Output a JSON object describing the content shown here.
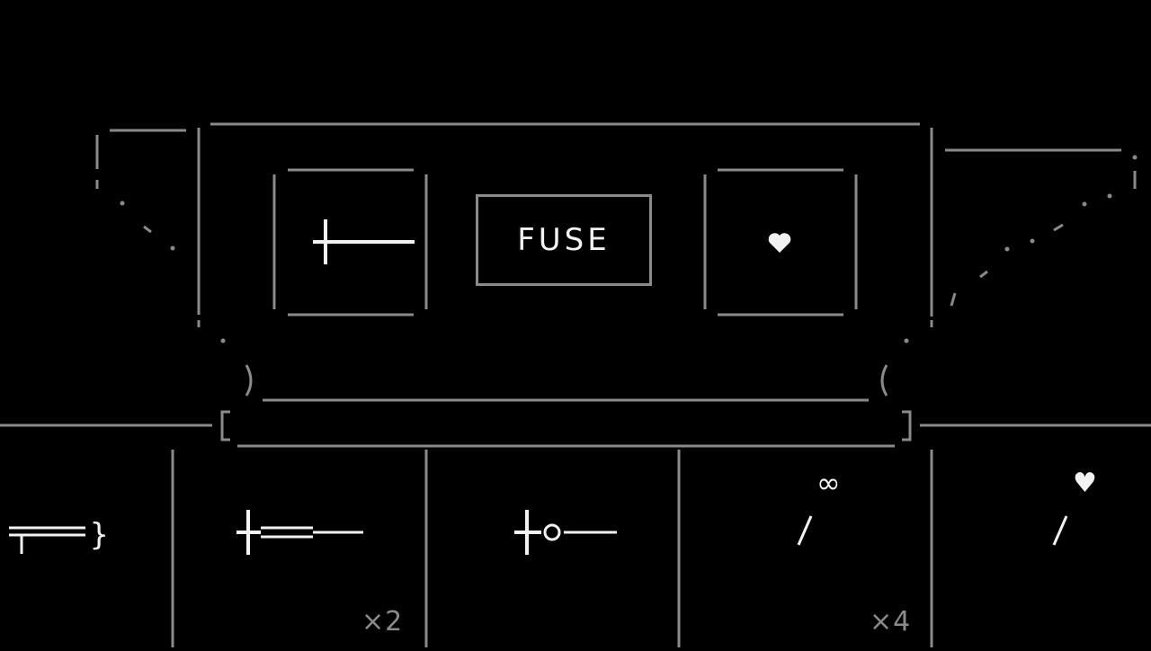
{
  "forge": {
    "fuse_label": "FUSE",
    "left_slot_item": "sword-icon",
    "right_slot_item": "heart-icon"
  },
  "inventory": {
    "items": [
      {
        "icon": "wide-sword-icon",
        "count": ""
      },
      {
        "icon": "double-sword-icon",
        "count": "×2"
      },
      {
        "icon": "ring-sword-icon",
        "count": ""
      },
      {
        "icon": "infinite-wand-icon",
        "badge": "∞",
        "count": "×4"
      },
      {
        "icon": "heart-wand-icon",
        "badge": "♥",
        "count": ""
      }
    ]
  },
  "colors": {
    "background": "#000000",
    "frame": "#8a8a8a",
    "item": "#f2f2f2"
  }
}
